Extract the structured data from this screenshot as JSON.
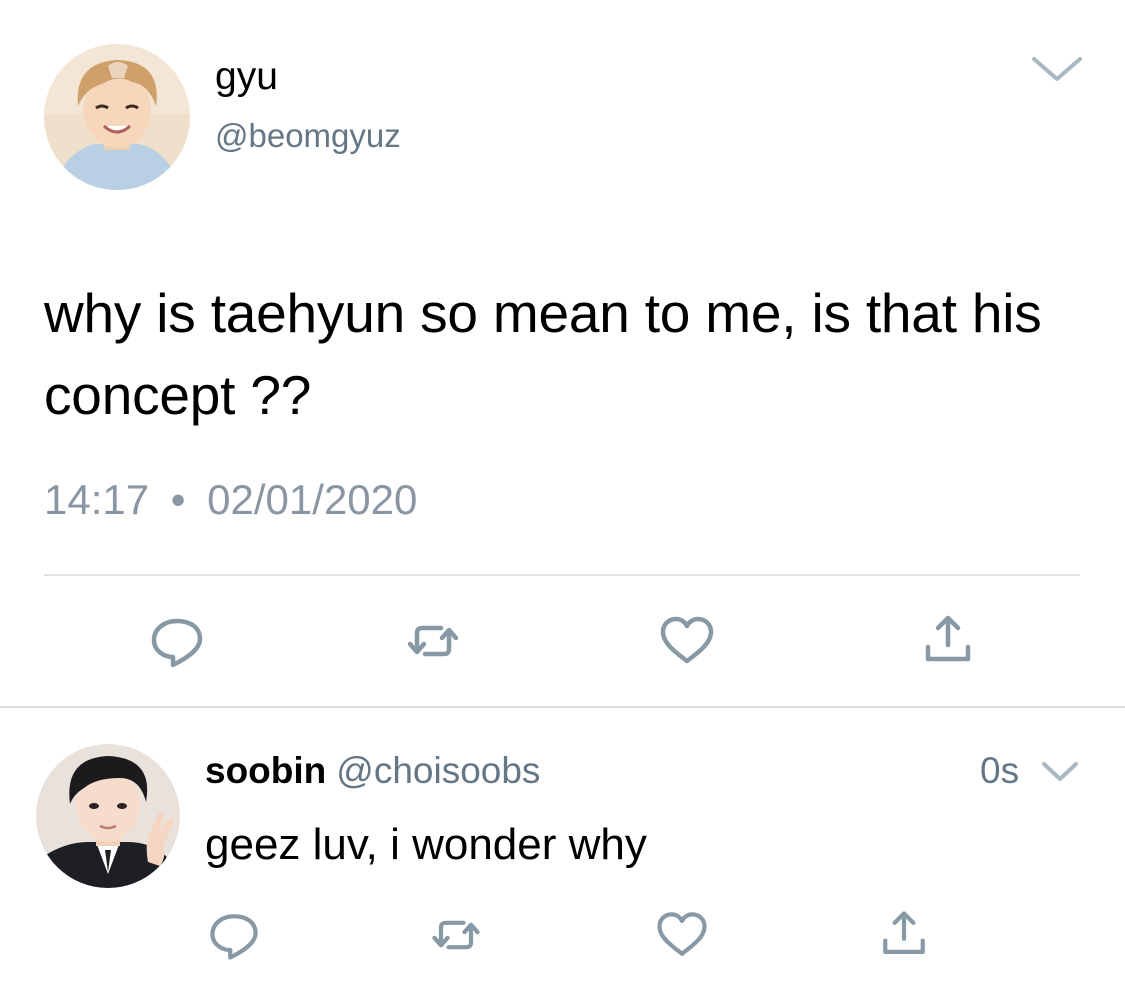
{
  "tweet": {
    "author": {
      "name": "gyu",
      "handle": "@beomgyuz",
      "avatar_icon": "profile-photo"
    },
    "text": "why is taehyun so mean to me, is that his concept ??",
    "time": "14:17",
    "separator": "•",
    "date": "02/01/2020",
    "menu_icon": "chevron-down-icon",
    "actions": [
      {
        "name": "reply",
        "icon": "reply-icon"
      },
      {
        "name": "retweet",
        "icon": "retweet-icon"
      },
      {
        "name": "like",
        "icon": "heart-icon"
      },
      {
        "name": "share",
        "icon": "share-icon"
      }
    ]
  },
  "reply": {
    "author": {
      "name": "soobin",
      "handle": "@choisoobs",
      "avatar_icon": "profile-photo"
    },
    "time": "0s",
    "text": "geez luv, i wonder why",
    "menu_icon": "chevron-down-icon",
    "actions": [
      {
        "name": "reply",
        "icon": "reply-icon"
      },
      {
        "name": "retweet",
        "icon": "retweet-icon"
      },
      {
        "name": "like",
        "icon": "heart-icon"
      },
      {
        "name": "share",
        "icon": "share-icon"
      }
    ]
  },
  "colors": {
    "secondary_text": "#657786",
    "icon": "#8899a6",
    "divider": "#dde3e8"
  }
}
